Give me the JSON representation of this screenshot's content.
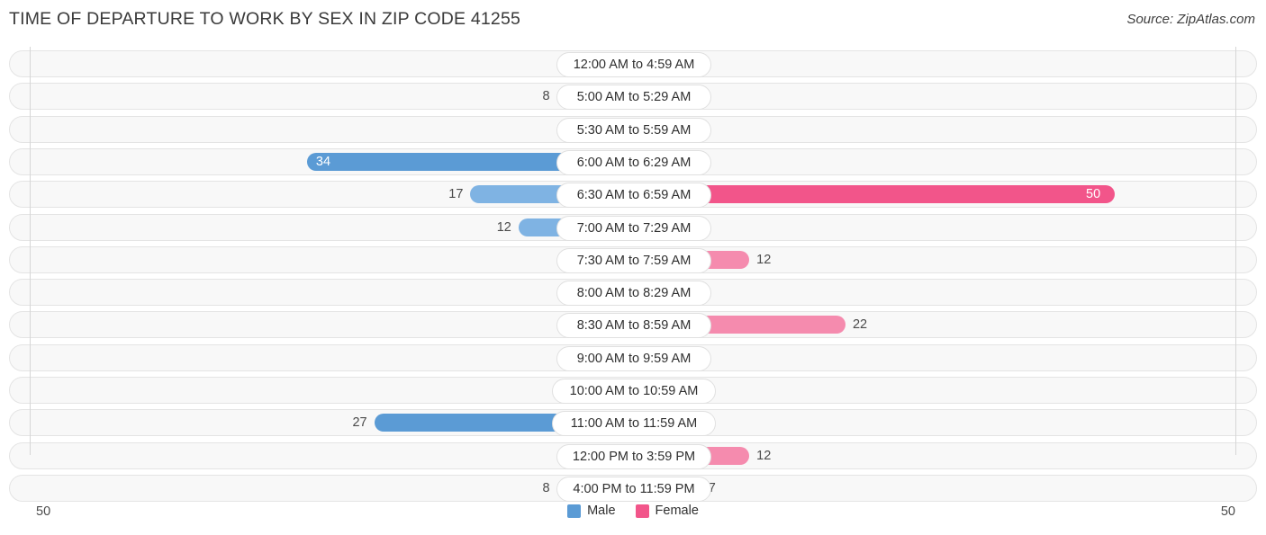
{
  "header": {
    "title": "TIME OF DEPARTURE TO WORK BY SEX IN ZIP CODE 41255",
    "source": "Source: ZipAtlas.com"
  },
  "axis": {
    "tick_left": "50",
    "tick_right": "50"
  },
  "legend": {
    "items": [
      {
        "label": "Male",
        "color": "#5B9BD5"
      },
      {
        "label": "Female",
        "color": "#F2558A"
      }
    ]
  },
  "colors": {
    "male_strong": "#5B9BD5",
    "male_mid": "#7FB3E3",
    "male_light": "#A8CBEC",
    "female_strong": "#F2558A",
    "female_mid": "#F58BAE",
    "female_light": "#F7A8C4",
    "track_fill": "#f8f8f8",
    "track_border": "#e4e4e4",
    "axis": "#d6d6d6"
  },
  "chart_data": {
    "type": "bar",
    "orientation": "horizontal",
    "layout": "diverging-bidirectional",
    "title": "TIME OF DEPARTURE TO WORK BY SEX IN ZIP CODE 41255",
    "xlabel": "",
    "ylabel": "",
    "xlim": [
      50,
      50
    ],
    "grid": false,
    "legend_position": "bottom-center",
    "categories": [
      "12:00 AM to 4:59 AM",
      "5:00 AM to 5:29 AM",
      "5:30 AM to 5:59 AM",
      "6:00 AM to 6:29 AM",
      "6:30 AM to 6:59 AM",
      "7:00 AM to 7:29 AM",
      "7:30 AM to 7:59 AM",
      "8:00 AM to 8:29 AM",
      "8:30 AM to 8:59 AM",
      "9:00 AM to 9:59 AM",
      "10:00 AM to 10:59 AM",
      "11:00 AM to 11:59 AM",
      "12:00 PM to 3:59 PM",
      "4:00 PM to 11:59 PM"
    ],
    "series": [
      {
        "name": "Male",
        "color": "#5B9BD5",
        "direction": "left",
        "values": [
          0,
          8,
          0,
          34,
          17,
          12,
          0,
          0,
          0,
          0,
          0,
          27,
          0,
          8
        ]
      },
      {
        "name": "Female",
        "color": "#F2558A",
        "direction": "right",
        "values": [
          0,
          0,
          0,
          0,
          50,
          0,
          12,
          0,
          22,
          0,
          0,
          0,
          12,
          7
        ]
      }
    ]
  }
}
